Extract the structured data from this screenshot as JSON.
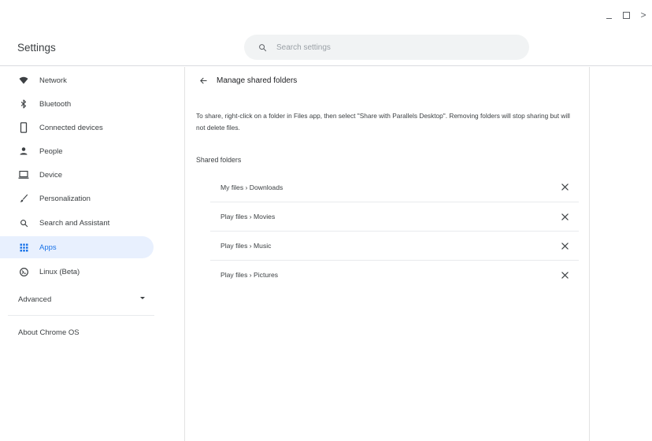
{
  "app": {
    "title": "Settings"
  },
  "window_controls": {
    "minimize_icon": "minimize-icon",
    "maximize_icon": "maximize-icon",
    "close_glyph": ">"
  },
  "search": {
    "placeholder": "Search settings",
    "value": ""
  },
  "sidebar": {
    "items": [
      {
        "label": "Network",
        "icon": "wifi-icon",
        "active": false
      },
      {
        "label": "Bluetooth",
        "icon": "bluetooth-icon",
        "active": false
      },
      {
        "label": "Connected devices",
        "icon": "phone-icon",
        "active": false
      },
      {
        "label": "People",
        "icon": "person-icon",
        "active": false
      },
      {
        "label": "Device",
        "icon": "laptop-icon",
        "active": false
      },
      {
        "label": "Personalization",
        "icon": "brush-icon",
        "active": false
      },
      {
        "label": "Search and Assistant",
        "icon": "search-icon",
        "active": false
      },
      {
        "label": "Apps",
        "icon": "apps-grid-icon",
        "active": true
      },
      {
        "label": "Linux (Beta)",
        "icon": "linux-icon",
        "active": false
      }
    ],
    "advanced_label": "Advanced",
    "about_label": "About Chrome OS"
  },
  "main": {
    "title": "Manage shared folders",
    "description": "To share, right-click on a folder in Files app, then select \"Share with Parallels Desktop\". Removing folders will stop sharing but will not delete files.",
    "section_title": "Shared folders",
    "folders": [
      {
        "label": "My files › Downloads"
      },
      {
        "label": "Play files › Movies"
      },
      {
        "label": "Play files › Music"
      },
      {
        "label": "Play files › Pictures"
      }
    ]
  },
  "colors": {
    "accent": "#1a73e8",
    "active_bg": "#e8f0fe",
    "text": "#3c4043",
    "icon": "#5f6368"
  }
}
